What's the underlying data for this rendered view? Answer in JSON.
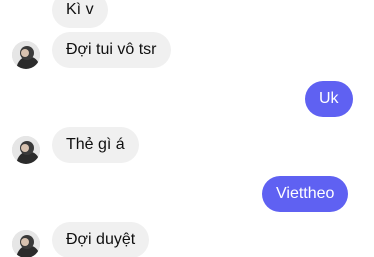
{
  "conversation": {
    "messages": [
      {
        "sender": "other",
        "text": "Kì v",
        "avatar": false
      },
      {
        "sender": "other",
        "text": "Đợi tui vô tsr",
        "avatar": true
      },
      {
        "sender": "me",
        "text": "Uk"
      },
      {
        "sender": "other",
        "text": "Thẻ gì á",
        "avatar": true
      },
      {
        "sender": "me",
        "text": "Viettheo"
      },
      {
        "sender": "other",
        "text": "Đợi duyệt",
        "avatar": true
      }
    ]
  },
  "colors": {
    "outgoing_bubble": "#5f61f2",
    "incoming_bubble": "#f0f0f0"
  }
}
